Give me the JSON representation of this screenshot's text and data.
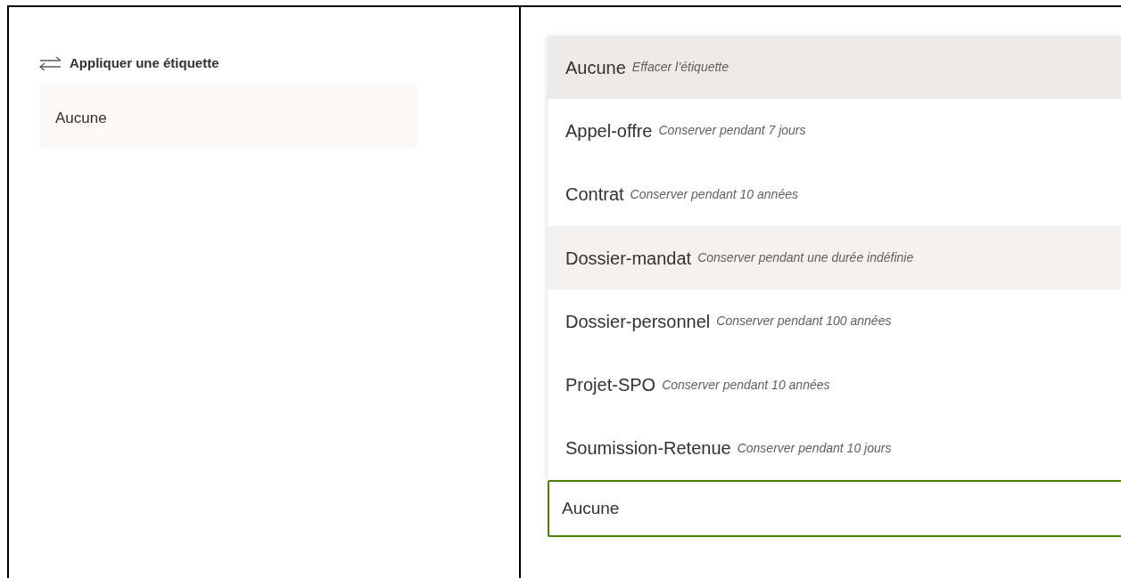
{
  "left_panel": {
    "title": "Appliquer une étiquette",
    "field": {
      "value": "Aucune"
    }
  },
  "dropdown": {
    "options": [
      {
        "label": "Aucune",
        "description": "Effacer l’étiquette",
        "selected": true,
        "hovered": false
      },
      {
        "label": "Appel-offre",
        "description": "Conserver pendant 7 jours",
        "selected": false,
        "hovered": false
      },
      {
        "label": "Contrat",
        "description": "Conserver pendant 10 années",
        "selected": false,
        "hovered": false
      },
      {
        "label": "Dossier-mandat",
        "description": "Conserver pendant une durée indéfinie",
        "selected": false,
        "hovered": true
      },
      {
        "label": "Dossier-personnel",
        "description": "Conserver pendant 100 années",
        "selected": false,
        "hovered": false
      },
      {
        "label": "Projet-SPO",
        "description": "Conserver pendant 10 années",
        "selected": false,
        "hovered": false
      },
      {
        "label": "Soumission-Retenue",
        "description": "Conserver pendant 10 jours",
        "selected": false,
        "hovered": false
      }
    ],
    "field": {
      "value": "Aucune"
    }
  }
}
